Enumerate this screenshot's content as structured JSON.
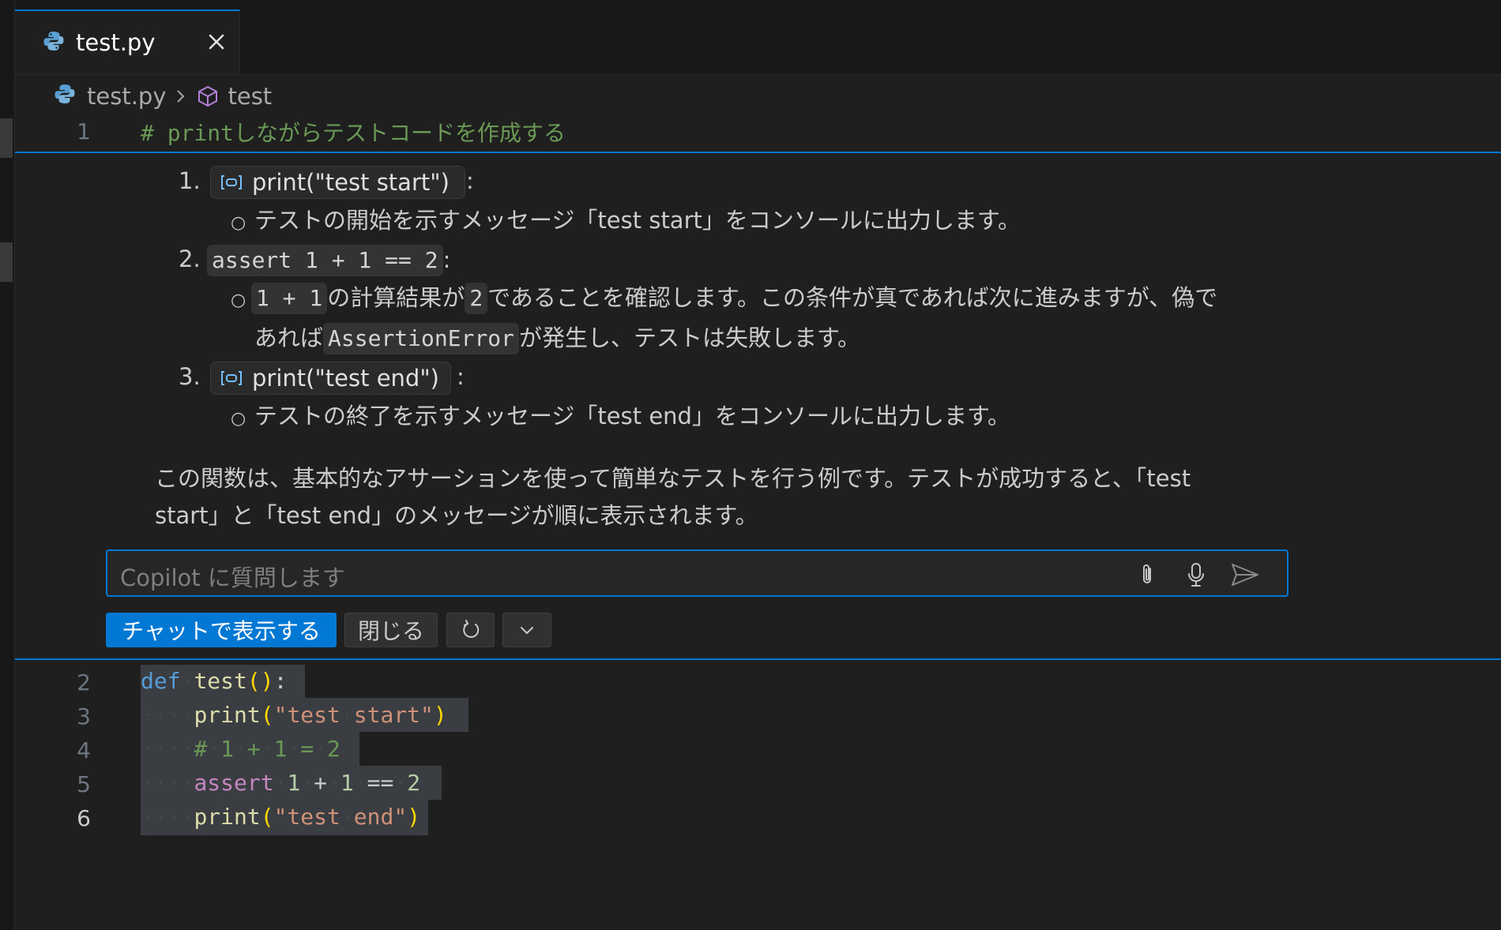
{
  "tab": {
    "label": "test.py"
  },
  "breadcrumb": {
    "file": "test.py",
    "symbol": "test"
  },
  "editor": {
    "line1": {
      "num": "1",
      "text": "# printしながらテストコードを作成する"
    },
    "lines": [
      {
        "num": "2"
      },
      {
        "num": "3"
      },
      {
        "num": "4"
      },
      {
        "num": "5"
      },
      {
        "num": "6"
      }
    ]
  },
  "chat": {
    "items": [
      {
        "num": "1.",
        "ref": "print(\"test start\")",
        "colon": ":",
        "desc": "テストの開始を示すメッセージ「test start」をコンソールに出力します。"
      },
      {
        "num": "2.",
        "code": "assert 1 + 1 == 2",
        "colon": ":",
        "desc_code1": "1 + 1",
        "desc_t1": "の計算結果が",
        "desc_code2": "2",
        "desc_t2": "であることを確認します。この条件が真であれば次に進みますが、偽で",
        "desc_t3": "あれば",
        "desc_code3": "AssertionError",
        "desc_t4": "が発生し、テストは失敗します。"
      },
      {
        "num": "3.",
        "ref": "print(\"test end\")",
        "colon": ":",
        "desc": "テストの終了を示すメッセージ「test end」をコンソールに出力します。"
      }
    ],
    "summary_line1": "この関数は、基本的なアサーションを使って簡単なテストを行う例です。テストが成功すると、「test",
    "summary_line2": "start」と「test end」のメッセージが順に表示されます。",
    "input_placeholder": "Copilot に質問します",
    "buttons": {
      "show_in_chat": "チャットで表示する",
      "close": "閉じる"
    }
  },
  "icons": {
    "python": "python-icon",
    "close": "close-icon",
    "symbol": "cube-icon",
    "attach": "paperclip-icon",
    "mic": "mic-icon",
    "send": "send-icon",
    "rerun": "refresh-icon",
    "more": "chevron-down-icon"
  },
  "colors": {
    "accent": "#0078d4",
    "background": "#1f1f1f"
  }
}
